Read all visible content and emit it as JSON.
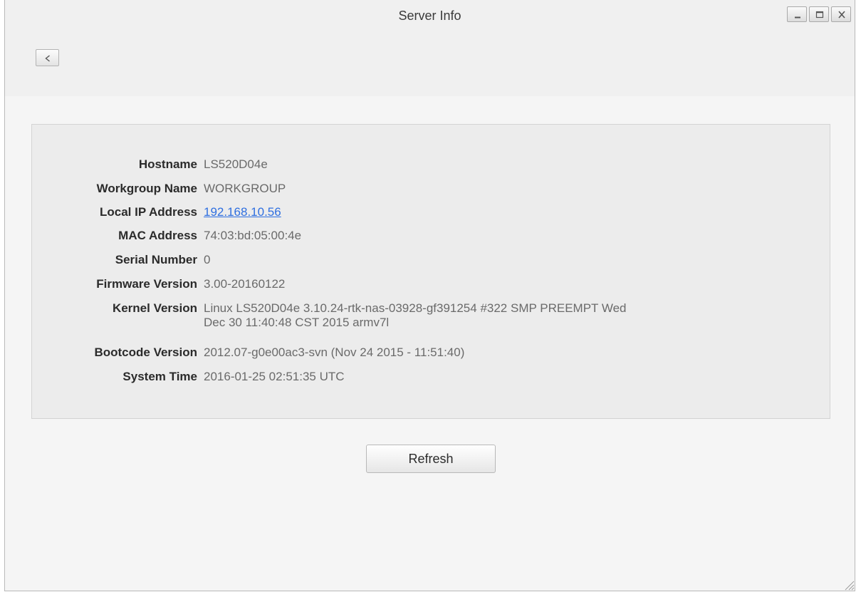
{
  "window": {
    "title": "Server Info"
  },
  "toolbar": {
    "back_label": "<"
  },
  "server_info": {
    "rows": [
      {
        "label": "Hostname",
        "value": "LS520D04e"
      },
      {
        "label": "Workgroup Name",
        "value": "WORKGROUP"
      },
      {
        "label": "Local IP Address",
        "value": "192.168.10.56"
      },
      {
        "label": "MAC Address",
        "value": "74:03:bd:05:00:4e"
      },
      {
        "label": "Serial Number",
        "value": "0"
      },
      {
        "label": "Firmware Version",
        "value": "3.00-20160122"
      },
      {
        "label": "Kernel Version",
        "value": "Linux LS520D04e 3.10.24-rtk-nas-03928-gf391254 #322 SMP PREEMPT Wed",
        "value_line2": "Dec 30 11:40:48 CST 2015 armv7l"
      },
      {
        "label": "Bootcode Version",
        "value": "2012.07-g0e00ac3-svn (Nov 24 2015 - 11:51:40)"
      },
      {
        "label": "System Time",
        "value": "2016-01-25 02:51:35 UTC"
      }
    ]
  },
  "actions": {
    "refresh_label": "Refresh"
  },
  "icons": {
    "minimize": "minimize-icon",
    "maximize": "maximize-icon",
    "close": "close-icon",
    "back": "chevron-left-icon",
    "resize": "resize-grip-icon"
  },
  "colors": {
    "link": "#2f6fe0",
    "label": "#2b2b2b",
    "value": "#6a6a6a",
    "panel_bg": "#ececec"
  }
}
